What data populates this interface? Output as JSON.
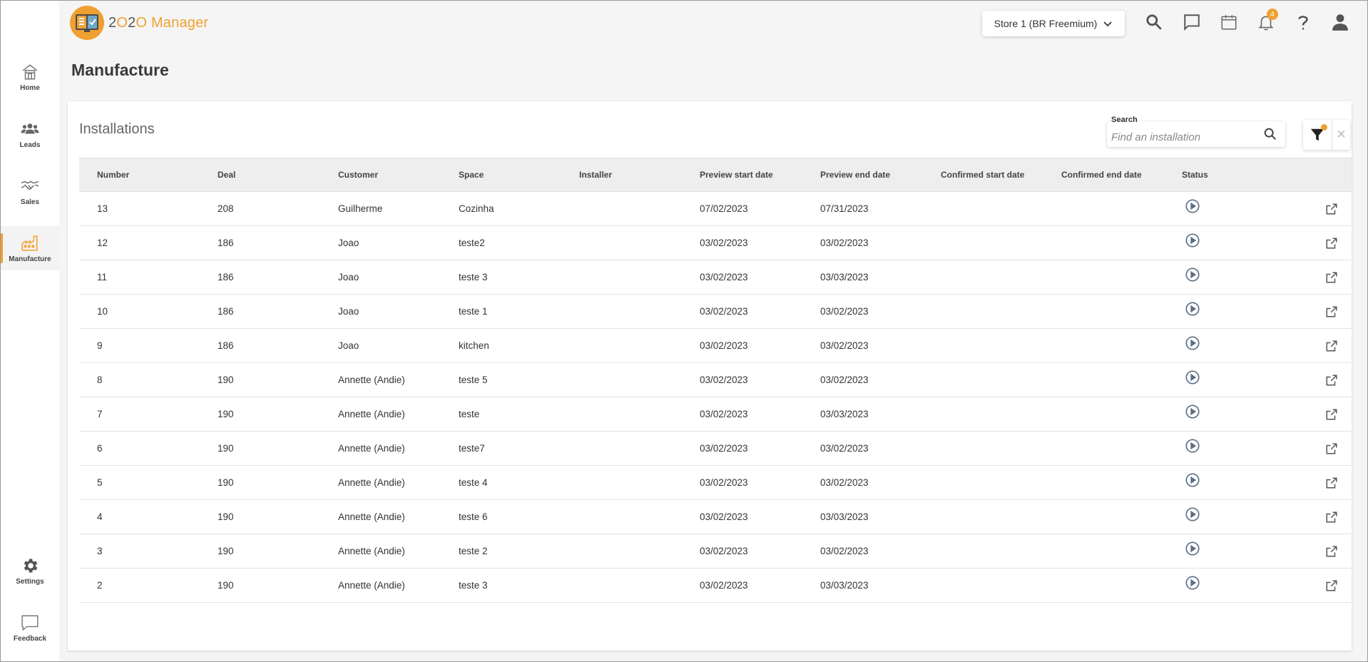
{
  "app": {
    "logo_text_prefix": "2",
    "logo_text_o1": "O",
    "logo_text_mid": "2",
    "logo_text_o2": "O",
    "logo_text_suffix": " Manager"
  },
  "sidebar": {
    "items": [
      {
        "label": "Home",
        "icon": "home-icon"
      },
      {
        "label": "Leads",
        "icon": "people-icon"
      },
      {
        "label": "Sales",
        "icon": "handshake-icon"
      },
      {
        "label": "Manufacture",
        "icon": "factory-icon"
      },
      {
        "label": "Settings",
        "icon": "gear-icon"
      },
      {
        "label": "Feedback",
        "icon": "chat-icon"
      }
    ],
    "active": "Manufacture"
  },
  "header": {
    "store": "Store 1 (BR Freemium)",
    "notifications_count": "4"
  },
  "page": {
    "title": "Manufacture"
  },
  "card": {
    "title": "Installations",
    "search_label": "Search",
    "search_placeholder": "Find an installation",
    "clear_symbol": "✕"
  },
  "table": {
    "columns": [
      "Number",
      "Deal",
      "Customer",
      "Space",
      "Installer",
      "Preview start date",
      "Preview end date",
      "Confirmed start date",
      "Confirmed end date",
      "Status"
    ],
    "rows": [
      {
        "number": "13",
        "deal": "208",
        "customer": "Guilherme",
        "space": "Cozinha",
        "installer": "",
        "preview_start": "07/02/2023",
        "preview_end": "07/31/2023",
        "confirmed_start": "",
        "confirmed_end": ""
      },
      {
        "number": "12",
        "deal": "186",
        "customer": "Joao",
        "space": "teste2",
        "installer": "",
        "preview_start": "03/02/2023",
        "preview_end": "03/02/2023",
        "confirmed_start": "",
        "confirmed_end": ""
      },
      {
        "number": "11",
        "deal": "186",
        "customer": "Joao",
        "space": "teste 3",
        "installer": "",
        "preview_start": "03/02/2023",
        "preview_end": "03/03/2023",
        "confirmed_start": "",
        "confirmed_end": ""
      },
      {
        "number": "10",
        "deal": "186",
        "customer": "Joao",
        "space": "teste 1",
        "installer": "",
        "preview_start": "03/02/2023",
        "preview_end": "03/02/2023",
        "confirmed_start": "",
        "confirmed_end": ""
      },
      {
        "number": "9",
        "deal": "186",
        "customer": "Joao",
        "space": "kitchen",
        "installer": "",
        "preview_start": "03/02/2023",
        "preview_end": "03/02/2023",
        "confirmed_start": "",
        "confirmed_end": ""
      },
      {
        "number": "8",
        "deal": "190",
        "customer": "Annette (Andie)",
        "space": "teste 5",
        "installer": "",
        "preview_start": "03/02/2023",
        "preview_end": "03/02/2023",
        "confirmed_start": "",
        "confirmed_end": ""
      },
      {
        "number": "7",
        "deal": "190",
        "customer": "Annette (Andie)",
        "space": "teste",
        "installer": "",
        "preview_start": "03/02/2023",
        "preview_end": "03/03/2023",
        "confirmed_start": "",
        "confirmed_end": ""
      },
      {
        "number": "6",
        "deal": "190",
        "customer": "Annette (Andie)",
        "space": "teste7",
        "installer": "",
        "preview_start": "03/02/2023",
        "preview_end": "03/02/2023",
        "confirmed_start": "",
        "confirmed_end": ""
      },
      {
        "number": "5",
        "deal": "190",
        "customer": "Annette (Andie)",
        "space": "teste 4",
        "installer": "",
        "preview_start": "03/02/2023",
        "preview_end": "03/02/2023",
        "confirmed_start": "",
        "confirmed_end": ""
      },
      {
        "number": "4",
        "deal": "190",
        "customer": "Annette (Andie)",
        "space": "teste 6",
        "installer": "",
        "preview_start": "03/02/2023",
        "preview_end": "03/03/2023",
        "confirmed_start": "",
        "confirmed_end": ""
      },
      {
        "number": "3",
        "deal": "190",
        "customer": "Annette (Andie)",
        "space": "teste 2",
        "installer": "",
        "preview_start": "03/02/2023",
        "preview_end": "03/02/2023",
        "confirmed_start": "",
        "confirmed_end": ""
      },
      {
        "number": "2",
        "deal": "190",
        "customer": "Annette (Andie)",
        "space": "teste 3",
        "installer": "",
        "preview_start": "03/02/2023",
        "preview_end": "03/03/2023",
        "confirmed_start": "",
        "confirmed_end": ""
      }
    ]
  },
  "colors": {
    "accent": "#f0a030",
    "status_icon": "#5a7083"
  }
}
